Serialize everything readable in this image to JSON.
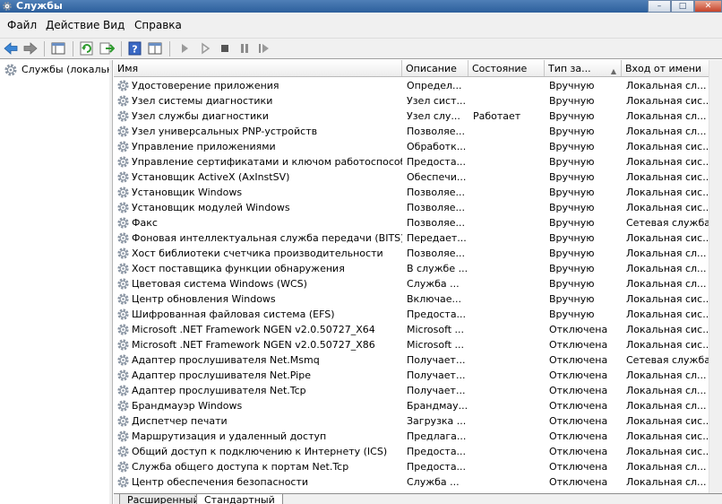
{
  "window": {
    "title": "Службы",
    "minimize_glyph": "–",
    "maximize_glyph": "□",
    "close_glyph": "✕"
  },
  "menu": [
    {
      "label": "Файл"
    },
    {
      "label": "Действие"
    },
    {
      "label": "Вид"
    },
    {
      "label": "Справка"
    }
  ],
  "toolbar_icons": [
    "back-icon",
    "forward-icon",
    "console-tree-icon",
    "refresh-icon",
    "export-list-icon",
    "help-icon",
    "properties-icon",
    "start-service-icon",
    "start-service-alt-icon",
    "stop-service-icon",
    "pause-service-icon",
    "restart-service-icon"
  ],
  "tree": {
    "root_label": "Службы (локальн"
  },
  "columns": {
    "name": "Имя",
    "description": "Описание",
    "state": "Состояние",
    "startup": "Тип за...",
    "logon": "Вход от имени"
  },
  "rows": [
    {
      "name": "Удостоверение приложения",
      "desc": "Определ...",
      "state": "",
      "start": "Вручную",
      "logon": "Локальная сл..."
    },
    {
      "name": "Узел системы диагностики",
      "desc": "Узел сист...",
      "state": "",
      "start": "Вручную",
      "logon": "Локальная сис..."
    },
    {
      "name": "Узел службы диагностики",
      "desc": "Узел слу...",
      "state": "Работает",
      "start": "Вручную",
      "logon": "Локальная сл..."
    },
    {
      "name": "Узел универсальных PNP-устройств",
      "desc": "Позволяе...",
      "state": "",
      "start": "Вручную",
      "logon": "Локальная сл..."
    },
    {
      "name": "Управление приложениями",
      "desc": "Обработк...",
      "state": "",
      "start": "Вручную",
      "logon": "Локальная сис..."
    },
    {
      "name": "Управление сертификатами и ключом работоспособности",
      "desc": "Предоста...",
      "state": "",
      "start": "Вручную",
      "logon": "Локальная сис..."
    },
    {
      "name": "Установщик ActiveX (AxInstSV)",
      "desc": "Обеспечи...",
      "state": "",
      "start": "Вручную",
      "logon": "Локальная сис..."
    },
    {
      "name": "Установщик Windows",
      "desc": "Позволяе...",
      "state": "",
      "start": "Вручную",
      "logon": "Локальная сис..."
    },
    {
      "name": "Установщик модулей Windows",
      "desc": "Позволяе...",
      "state": "",
      "start": "Вручную",
      "logon": "Локальная сис..."
    },
    {
      "name": "Факс",
      "desc": "Позволяе...",
      "state": "",
      "start": "Вручную",
      "logon": "Сетевая служба"
    },
    {
      "name": "Фоновая интеллектуальная служба передачи (BITS)",
      "desc": "Передает...",
      "state": "",
      "start": "Вручную",
      "logon": "Локальная сис..."
    },
    {
      "name": "Хост библиотеки счетчика производительности",
      "desc": "Позволяе...",
      "state": "",
      "start": "Вручную",
      "logon": "Локальная сл..."
    },
    {
      "name": "Хост поставщика функции обнаружения",
      "desc": "В службе ...",
      "state": "",
      "start": "Вручную",
      "logon": "Локальная сл..."
    },
    {
      "name": "Цветовая система Windows (WCS)",
      "desc": "Служба ...",
      "state": "",
      "start": "Вручную",
      "logon": "Локальная сл..."
    },
    {
      "name": "Центр обновления Windows",
      "desc": "Включае...",
      "state": "",
      "start": "Вручную",
      "logon": "Локальная сис..."
    },
    {
      "name": "Шифрованная файловая система (EFS)",
      "desc": "Предоста...",
      "state": "",
      "start": "Вручную",
      "logon": "Локальная сис..."
    },
    {
      "name": "Microsoft .NET Framework NGEN v2.0.50727_X64",
      "desc": "Microsoft ...",
      "state": "",
      "start": "Отключена",
      "logon": "Локальная сис..."
    },
    {
      "name": "Microsoft .NET Framework NGEN v2.0.50727_X86",
      "desc": "Microsoft ...",
      "state": "",
      "start": "Отключена",
      "logon": "Локальная сис..."
    },
    {
      "name": "Адаптер прослушивателя Net.Msmq",
      "desc": "Получает...",
      "state": "",
      "start": "Отключена",
      "logon": "Сетевая служба"
    },
    {
      "name": "Адаптер прослушивателя Net.Pipe",
      "desc": "Получает...",
      "state": "",
      "start": "Отключена",
      "logon": "Локальная сл..."
    },
    {
      "name": "Адаптер прослушивателя Net.Tcp",
      "desc": "Получает...",
      "state": "",
      "start": "Отключена",
      "logon": "Локальная сл..."
    },
    {
      "name": "Брандмауэр Windows",
      "desc": "Брандмау...",
      "state": "",
      "start": "Отключена",
      "logon": "Локальная сл..."
    },
    {
      "name": "Диспетчер печати",
      "desc": "Загрузка ...",
      "state": "",
      "start": "Отключена",
      "logon": "Локальная сис..."
    },
    {
      "name": "Маршрутизация и удаленный доступ",
      "desc": "Предлага...",
      "state": "",
      "start": "Отключена",
      "logon": "Локальная сис..."
    },
    {
      "name": "Общий доступ к подключению к Интернету (ICS)",
      "desc": "Предоста...",
      "state": "",
      "start": "Отключена",
      "logon": "Локальная сис..."
    },
    {
      "name": "Служба общего доступа к портам Net.Tcp",
      "desc": "Предоста...",
      "state": "",
      "start": "Отключена",
      "logon": "Локальная сл..."
    },
    {
      "name": "Центр обеспечения безопасности",
      "desc": "Служба ...",
      "state": "",
      "start": "Отключена",
      "logon": "Локальная сл..."
    }
  ],
  "tabs": [
    {
      "label": "Расширенный"
    },
    {
      "label": "Стандартный"
    }
  ],
  "colors": {
    "titlebar": "#2c5f9c",
    "menu_bg": "#f0f0f0",
    "gear": "#7f8a96"
  }
}
